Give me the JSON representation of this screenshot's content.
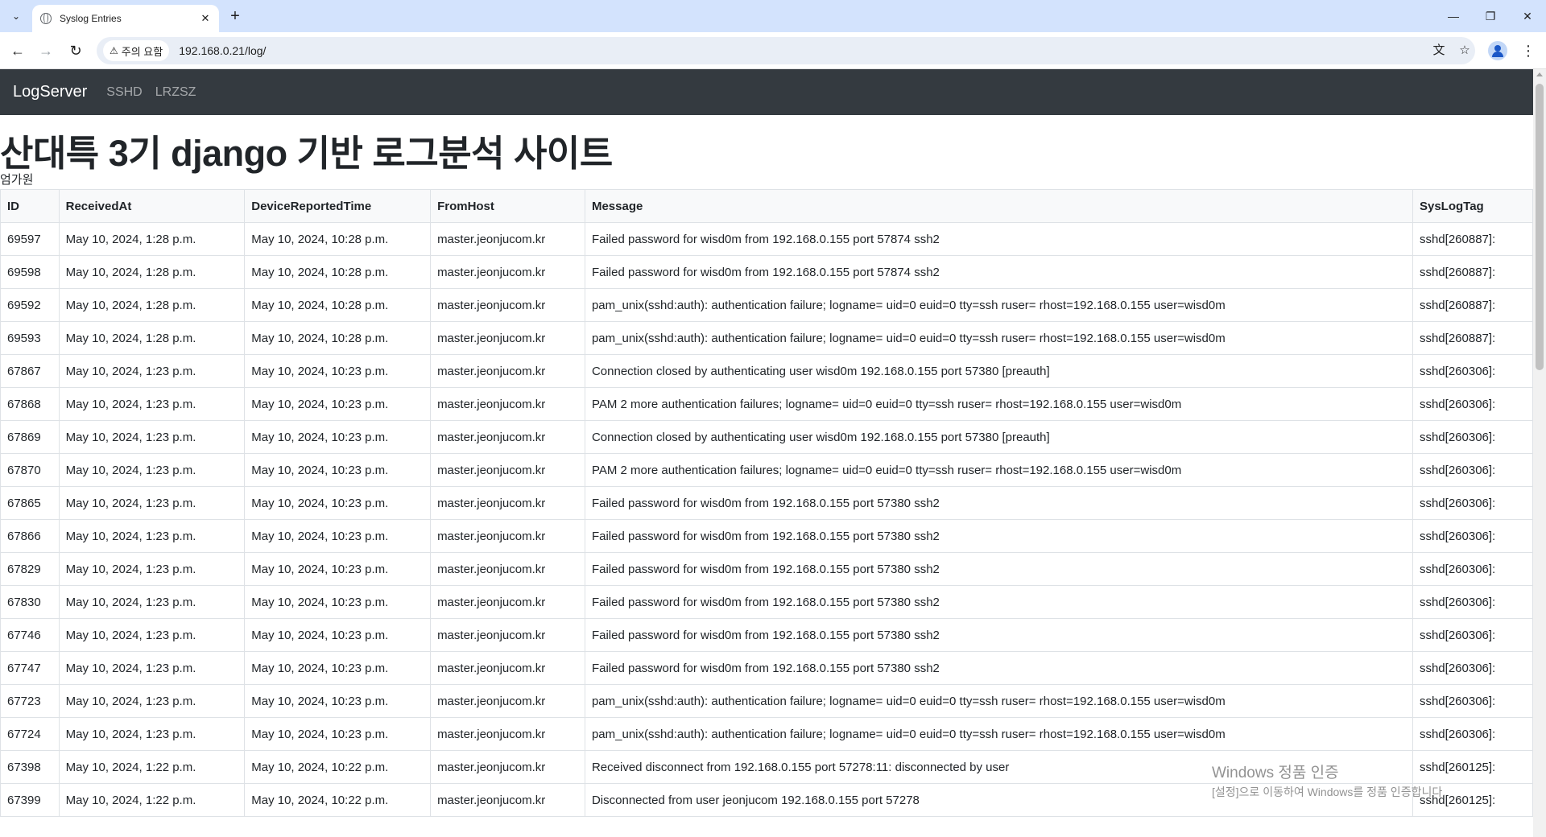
{
  "browser": {
    "tab_title": "Syslog Entries",
    "security_label": "주의 요함",
    "url": "192.168.0.21/log/"
  },
  "navbar": {
    "brand": "LogServer",
    "links": [
      "SSHD",
      "LRZSZ"
    ]
  },
  "page": {
    "heading": "산대특 3기 django 기반 로그분석 사이트",
    "author": "엄가원"
  },
  "table": {
    "columns": [
      "ID",
      "ReceivedAt",
      "DeviceReportedTime",
      "FromHost",
      "Message",
      "SysLogTag"
    ],
    "rows": [
      [
        "69597",
        "May 10, 2024, 1:28 p.m.",
        "May 10, 2024, 10:28 p.m.",
        "master.jeonjucom.kr",
        "Failed password for wisd0m from 192.168.0.155 port 57874 ssh2",
        "sshd[260887]:"
      ],
      [
        "69598",
        "May 10, 2024, 1:28 p.m.",
        "May 10, 2024, 10:28 p.m.",
        "master.jeonjucom.kr",
        "Failed password for wisd0m from 192.168.0.155 port 57874 ssh2",
        "sshd[260887]:"
      ],
      [
        "69592",
        "May 10, 2024, 1:28 p.m.",
        "May 10, 2024, 10:28 p.m.",
        "master.jeonjucom.kr",
        "pam_unix(sshd:auth): authentication failure; logname= uid=0 euid=0 tty=ssh ruser= rhost=192.168.0.155 user=wisd0m",
        "sshd[260887]:"
      ],
      [
        "69593",
        "May 10, 2024, 1:28 p.m.",
        "May 10, 2024, 10:28 p.m.",
        "master.jeonjucom.kr",
        "pam_unix(sshd:auth): authentication failure; logname= uid=0 euid=0 tty=ssh ruser= rhost=192.168.0.155 user=wisd0m",
        "sshd[260887]:"
      ],
      [
        "67867",
        "May 10, 2024, 1:23 p.m.",
        "May 10, 2024, 10:23 p.m.",
        "master.jeonjucom.kr",
        "Connection closed by authenticating user wisd0m 192.168.0.155 port 57380 [preauth]",
        "sshd[260306]:"
      ],
      [
        "67868",
        "May 10, 2024, 1:23 p.m.",
        "May 10, 2024, 10:23 p.m.",
        "master.jeonjucom.kr",
        "PAM 2 more authentication failures; logname= uid=0 euid=0 tty=ssh ruser= rhost=192.168.0.155 user=wisd0m",
        "sshd[260306]:"
      ],
      [
        "67869",
        "May 10, 2024, 1:23 p.m.",
        "May 10, 2024, 10:23 p.m.",
        "master.jeonjucom.kr",
        "Connection closed by authenticating user wisd0m 192.168.0.155 port 57380 [preauth]",
        "sshd[260306]:"
      ],
      [
        "67870",
        "May 10, 2024, 1:23 p.m.",
        "May 10, 2024, 10:23 p.m.",
        "master.jeonjucom.kr",
        "PAM 2 more authentication failures; logname= uid=0 euid=0 tty=ssh ruser= rhost=192.168.0.155 user=wisd0m",
        "sshd[260306]:"
      ],
      [
        "67865",
        "May 10, 2024, 1:23 p.m.",
        "May 10, 2024, 10:23 p.m.",
        "master.jeonjucom.kr",
        "Failed password for wisd0m from 192.168.0.155 port 57380 ssh2",
        "sshd[260306]:"
      ],
      [
        "67866",
        "May 10, 2024, 1:23 p.m.",
        "May 10, 2024, 10:23 p.m.",
        "master.jeonjucom.kr",
        "Failed password for wisd0m from 192.168.0.155 port 57380 ssh2",
        "sshd[260306]:"
      ],
      [
        "67829",
        "May 10, 2024, 1:23 p.m.",
        "May 10, 2024, 10:23 p.m.",
        "master.jeonjucom.kr",
        "Failed password for wisd0m from 192.168.0.155 port 57380 ssh2",
        "sshd[260306]:"
      ],
      [
        "67830",
        "May 10, 2024, 1:23 p.m.",
        "May 10, 2024, 10:23 p.m.",
        "master.jeonjucom.kr",
        "Failed password for wisd0m from 192.168.0.155 port 57380 ssh2",
        "sshd[260306]:"
      ],
      [
        "67746",
        "May 10, 2024, 1:23 p.m.",
        "May 10, 2024, 10:23 p.m.",
        "master.jeonjucom.kr",
        "Failed password for wisd0m from 192.168.0.155 port 57380 ssh2",
        "sshd[260306]:"
      ],
      [
        "67747",
        "May 10, 2024, 1:23 p.m.",
        "May 10, 2024, 10:23 p.m.",
        "master.jeonjucom.kr",
        "Failed password for wisd0m from 192.168.0.155 port 57380 ssh2",
        "sshd[260306]:"
      ],
      [
        "67723",
        "May 10, 2024, 1:23 p.m.",
        "May 10, 2024, 10:23 p.m.",
        "master.jeonjucom.kr",
        "pam_unix(sshd:auth): authentication failure; logname= uid=0 euid=0 tty=ssh ruser= rhost=192.168.0.155 user=wisd0m",
        "sshd[260306]:"
      ],
      [
        "67724",
        "May 10, 2024, 1:23 p.m.",
        "May 10, 2024, 10:23 p.m.",
        "master.jeonjucom.kr",
        "pam_unix(sshd:auth): authentication failure; logname= uid=0 euid=0 tty=ssh ruser= rhost=192.168.0.155 user=wisd0m",
        "sshd[260306]:"
      ],
      [
        "67398",
        "May 10, 2024, 1:22 p.m.",
        "May 10, 2024, 10:22 p.m.",
        "master.jeonjucom.kr",
        "Received disconnect from 192.168.0.155 port 57278:11: disconnected by user",
        "sshd[260125]:"
      ],
      [
        "67399",
        "May 10, 2024, 1:22 p.m.",
        "May 10, 2024, 10:22 p.m.",
        "master.jeonjucom.kr",
        "Disconnected from user jeonjucom 192.168.0.155 port 57278",
        "sshd[260125]:"
      ]
    ]
  },
  "watermark": {
    "line1": "Windows 정품 인증",
    "line2": "[설정]으로 이동하여 Windows를 정품 인증합니다."
  }
}
